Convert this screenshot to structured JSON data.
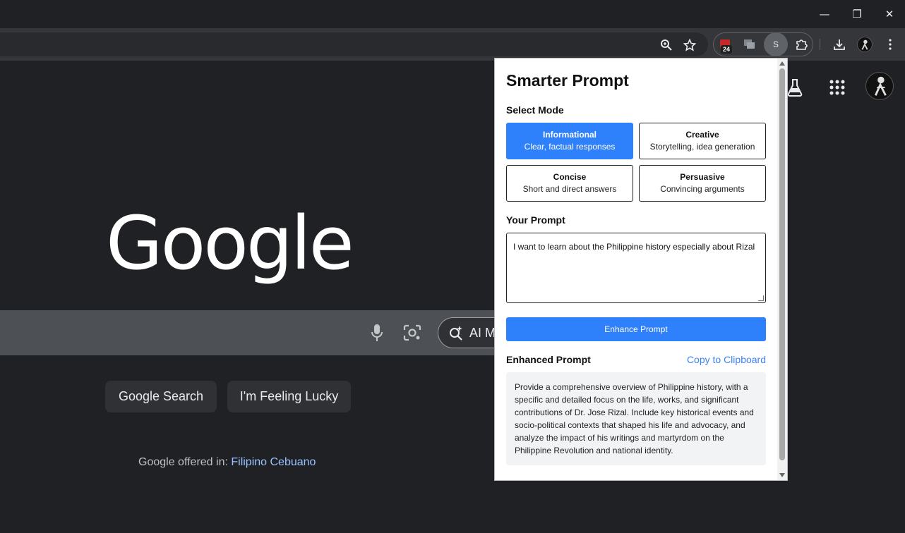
{
  "window_controls": {
    "minimize": "—",
    "restore": "❐",
    "close": "✕"
  },
  "toolbar": {
    "extension_badge": "24",
    "extension_s_label": "S"
  },
  "page": {
    "logo": "Google",
    "ai_mode_label": "AI Mo",
    "search_button": "Google Search",
    "lucky_button": "I'm Feeling Lucky",
    "offered_in": "Google offered in:",
    "languages": [
      "Filipino",
      "Cebuano"
    ]
  },
  "popup": {
    "title": "Smarter Prompt",
    "select_mode_label": "Select Mode",
    "modes": [
      {
        "title": "Informational",
        "desc": "Clear, factual responses",
        "active": true
      },
      {
        "title": "Creative",
        "desc": "Storytelling, idea generation",
        "active": false
      },
      {
        "title": "Concise",
        "desc": "Short and direct answers",
        "active": false
      },
      {
        "title": "Persuasive",
        "desc": "Convincing arguments",
        "active": false
      }
    ],
    "your_prompt_label": "Your Prompt",
    "prompt_value": "I want to learn about the Philippine history especially about Rizal",
    "enhance_button": "Enhance Prompt",
    "enhanced_label": "Enhanced Prompt",
    "copy_button": "Copy to Clipboard",
    "enhanced_text": "Provide a comprehensive overview of Philippine history, with a specific and detailed focus on the life, works, and significant contributions of Dr. Jose Rizal. Include key historical events and socio-political contexts that shaped his life and advocacy, and analyze the impact of his writings and martyrdom on the Philippine Revolution and national identity."
  },
  "colors": {
    "accent": "#2f80fb",
    "link": "#3b82f6",
    "page_bg": "#202124"
  }
}
